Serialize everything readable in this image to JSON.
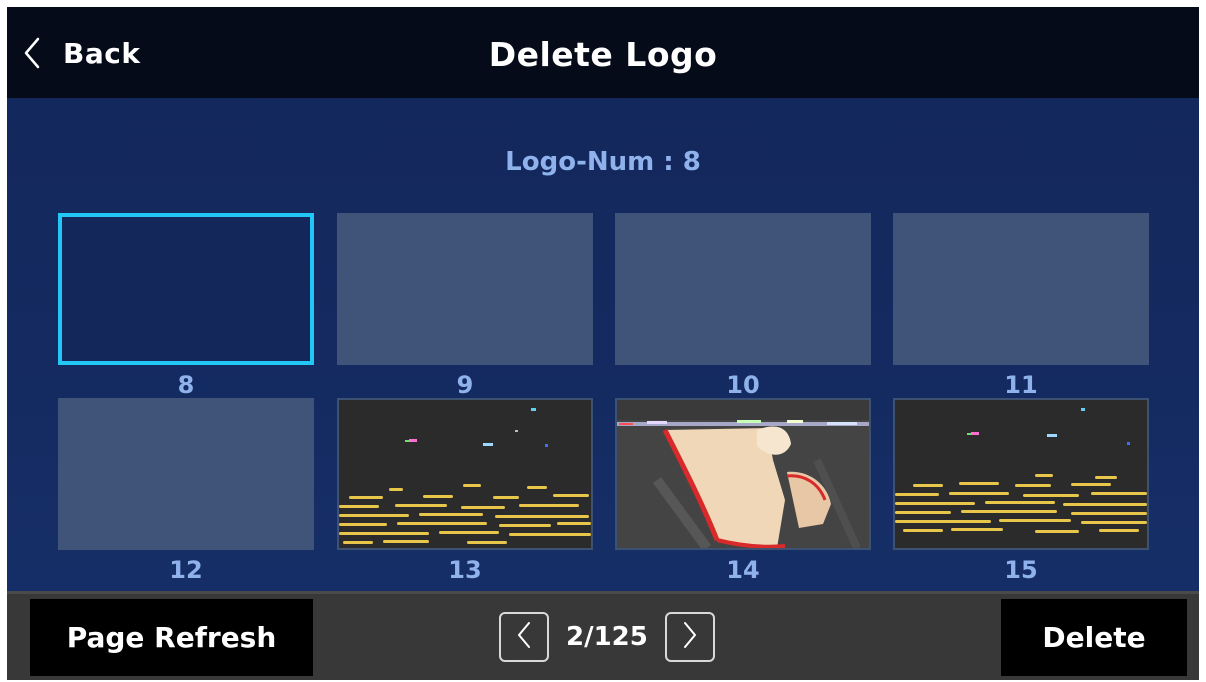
{
  "header": {
    "back_label": "Back",
    "title": "Delete Logo"
  },
  "logo_num_text": "Logo-Num : 8",
  "selected_logo": 8,
  "slots": [
    {
      "number": "8",
      "state": "selected-empty"
    },
    {
      "number": "9",
      "state": "empty"
    },
    {
      "number": "10",
      "state": "empty"
    },
    {
      "number": "11",
      "state": "empty"
    },
    {
      "number": "12",
      "state": "empty"
    },
    {
      "number": "13",
      "state": "image"
    },
    {
      "number": "14",
      "state": "image"
    },
    {
      "number": "15",
      "state": "image"
    }
  ],
  "footer": {
    "refresh_label": "Page Refresh",
    "page_indicator": "2/125",
    "delete_label": "Delete"
  },
  "colors": {
    "background": "#13275a",
    "topbar": "#050b19",
    "empty_slot": "#3f5478",
    "selection_border": "#23c7f5",
    "label": "#8fb2ec",
    "footer": "#383838"
  }
}
